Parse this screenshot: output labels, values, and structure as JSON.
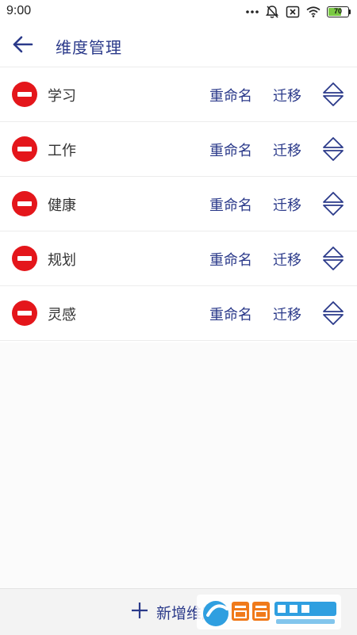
{
  "status_bar": {
    "time": "9:00",
    "battery_level": "70",
    "battery_fraction": 0.7
  },
  "header": {
    "back_icon": "arrow-left-icon",
    "title": "维度管理"
  },
  "dimensions": [
    {
      "name": "学习",
      "rename_label": "重命名",
      "migrate_label": "迁移"
    },
    {
      "name": "工作",
      "rename_label": "重命名",
      "migrate_label": "迁移"
    },
    {
      "name": "健康",
      "rename_label": "重命名",
      "migrate_label": "迁移"
    },
    {
      "name": "规划",
      "rename_label": "重命名",
      "migrate_label": "迁移"
    },
    {
      "name": "灵感",
      "rename_label": "重命名",
      "migrate_label": "迁移"
    }
  ],
  "footer": {
    "add_icon": "plus-icon",
    "add_label": "新增维度"
  },
  "colors": {
    "accent": "#2b3a8a",
    "remove": "#e4161b",
    "battery": "#7ac943"
  }
}
